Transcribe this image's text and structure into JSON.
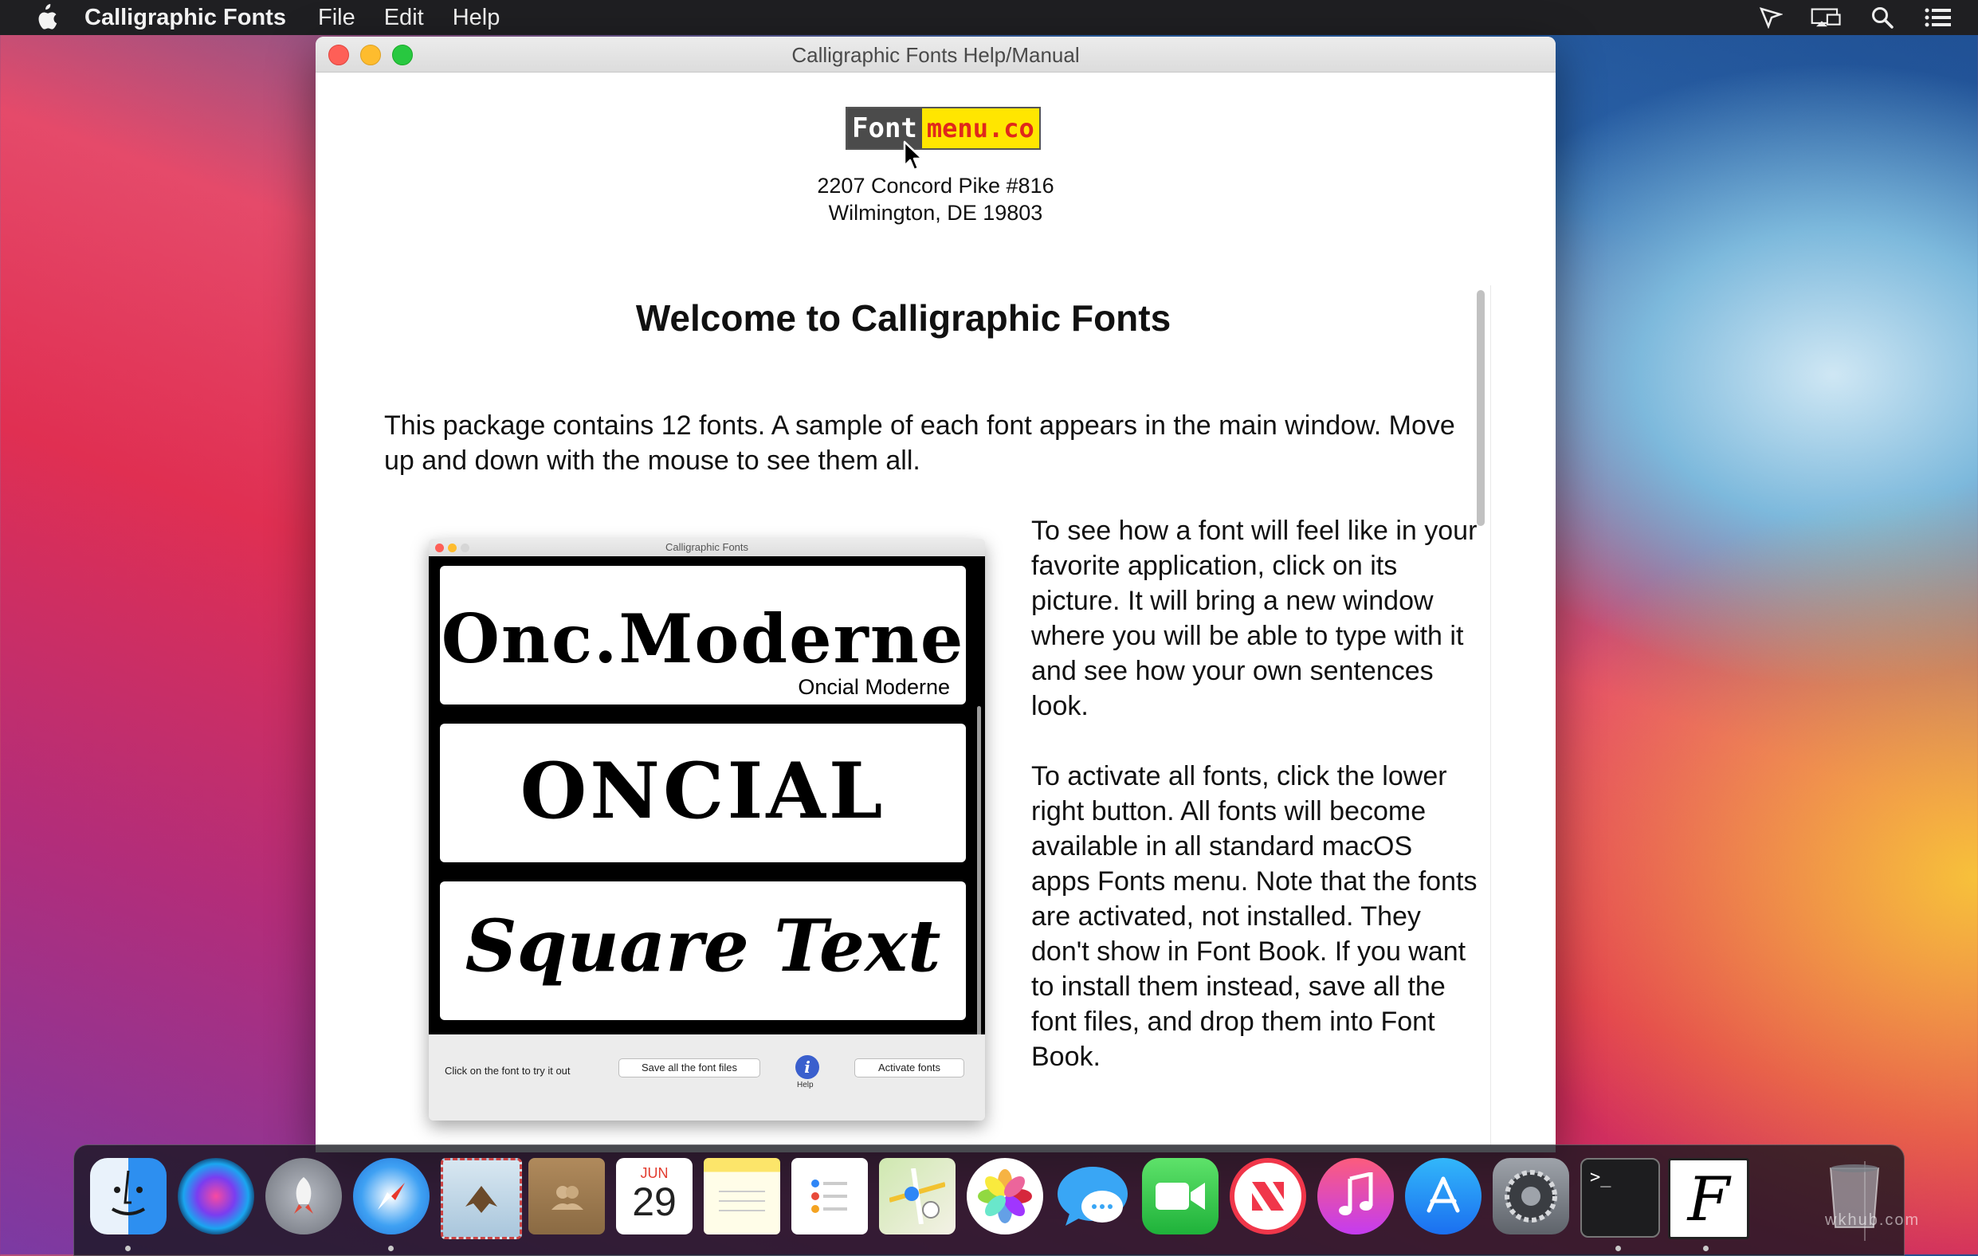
{
  "menubar": {
    "app_name": "Calligraphic Fonts",
    "menus": [
      "File",
      "Edit",
      "Help"
    ],
    "status_icons": [
      "pointer-tool-icon",
      "screen-mirroring-icon",
      "spotlight-search-icon",
      "notification-center-icon"
    ]
  },
  "window": {
    "title": "Calligraphic Fonts Help/Manual",
    "logo": {
      "part1": "Font",
      "part2": "menu.co"
    },
    "address_line1": "2207 Concord Pike #816",
    "address_line2": "Wilmington, DE 19803",
    "heading": "Welcome to Calligraphic Fonts",
    "intro": "This package contains 12 fonts. A sample of each font appears in the main window. Move up and down with the mouse to see them all.",
    "tryout_text": "To see how a font will feel like in your favorite application, click on its picture. It will bring a new window where you will be able to type with it and see how your own sentences look.",
    "activate_text": "To activate all fonts, click the lower right button. All fonts will become available in all standard macOS apps Fonts menu. Note that the fonts are activated, not installed. They don't show in Font Book. If you want to install them instead, save all the font files, and drop them into Font Book."
  },
  "screenshot": {
    "title": "Calligraphic Fonts",
    "fonts": [
      {
        "sample": "Onc.Moderne",
        "caption": "Oncial Moderne"
      },
      {
        "sample": "ONCIAL",
        "caption": ""
      },
      {
        "sample": "Square Text",
        "caption": ""
      }
    ],
    "hint": "Click on the font to try it out",
    "save_button": "Save all the font files",
    "help_label": "Help",
    "help_glyph": "i",
    "activate_button": "Activate fonts"
  },
  "dock": {
    "apps": [
      "Finder",
      "Siri",
      "Launchpad",
      "Safari",
      "Mail",
      "Contacts",
      "Calendar",
      "Notes",
      "Reminders",
      "Maps",
      "Photos",
      "Messages",
      "FaceTime",
      "News",
      "Music",
      "App Store",
      "System Preferences",
      "Terminal",
      "Calligraphic Fonts",
      "Trash"
    ],
    "calendar_month": "JUN",
    "calendar_day": "29",
    "terminal_prompt": ">_",
    "fonts_app_glyph": "F"
  },
  "watermark": "wkhub.com",
  "colors": {
    "menubar_bg": "#1f1f22",
    "close": "#fe5f57",
    "minimize": "#febc2e",
    "zoom": "#28c840",
    "logo_dark": "#4b4b4b",
    "logo_yellow": "#ffe600",
    "logo_red": "#e0281b",
    "help_blue": "#3a5fcd"
  }
}
